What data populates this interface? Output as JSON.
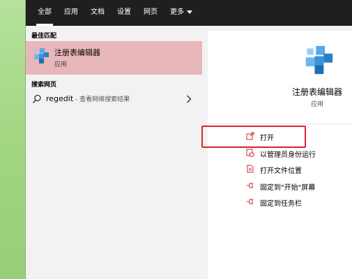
{
  "tabs": [
    {
      "label": "全部",
      "active": true
    },
    {
      "label": "应用"
    },
    {
      "label": "文档"
    },
    {
      "label": "设置"
    },
    {
      "label": "网页"
    },
    {
      "label": "更多"
    }
  ],
  "left": {
    "best_match_header": "最佳匹配",
    "best_match": {
      "title": "注册表编辑器",
      "subtitle": "应用",
      "icon": "registry-editor-icon"
    },
    "web_header": "搜索网页",
    "web_result": {
      "query": "regedit",
      "suffix": " - 查看网络搜索结果",
      "icon": "search-icon"
    }
  },
  "right": {
    "app_title": "注册表编辑器",
    "app_subtitle": "应用",
    "actions": [
      {
        "label": "打开",
        "icon": "open-icon"
      },
      {
        "label": "以管理员身份运行",
        "icon": "run-as-admin-icon"
      },
      {
        "label": "打开文件位置",
        "icon": "file-location-icon"
      },
      {
        "label": "固定到\"开始\"屏幕",
        "icon": "pin-icon"
      },
      {
        "label": "固定到任务栏",
        "icon": "pin-icon"
      }
    ]
  },
  "colors": {
    "accent_red": "#d9242b",
    "selection": "#e8b7b9",
    "tabbar": "#1f1f1f"
  }
}
